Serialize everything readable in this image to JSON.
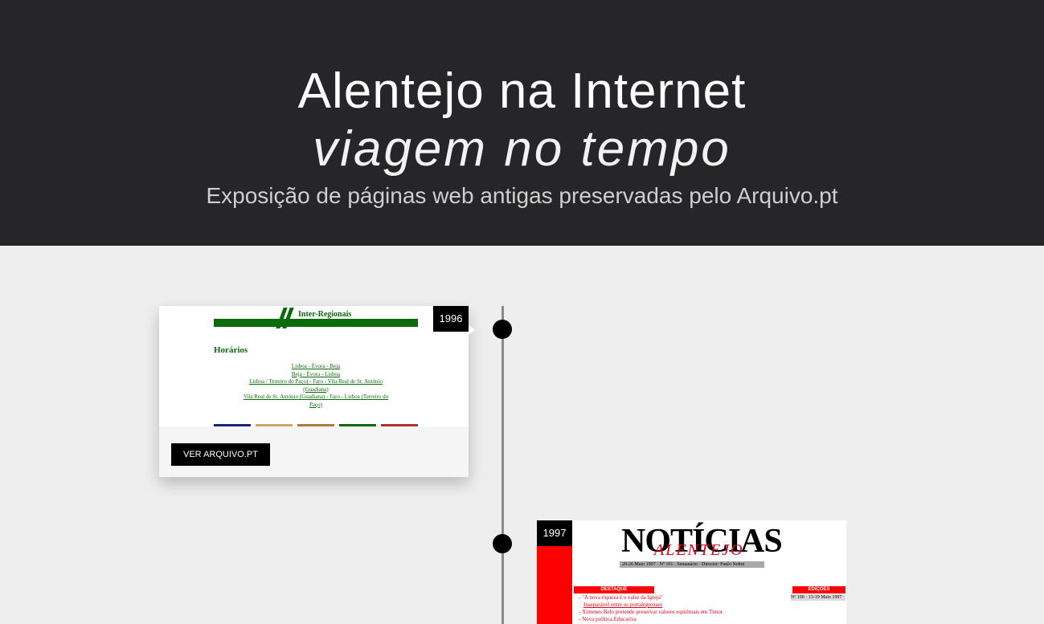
{
  "header": {
    "title": "Alentejo na Internet",
    "subtitle": "viagem no tempo",
    "description": "Exposição de páginas web antigas preservadas pelo Arquivo.pt"
  },
  "timeline": {
    "items": [
      {
        "year": "1996",
        "button_label": "VER ARQUIVO.PT",
        "screenshot": {
          "site_title": "Inter-Regionais",
          "heading": "Horários",
          "links": [
            "Lisboa - Évora - Beja",
            "Beja - Évora - Lisboa",
            "Lisboa / Terreiro do Paço) - Faro - Vila Real de St. António (Guadiana)",
            "Vila Real de St. António (Guadiana) - Faro - Lisboa (Terreiro do Paço)"
          ],
          "tab_colors": [
            "#1a237e",
            "#c9a56b",
            "#b07a3a",
            "#0b6b0b",
            "#a33"
          ]
        }
      },
      {
        "year": "1997",
        "screenshot": {
          "masthead": "NOTÍCIAS",
          "masthead_sub": "ALENTEJO",
          "dateline": "20-26 Maio 1997 · Nº 101 · Semanário · Director: Paulo Nobre",
          "destaque_label": "DESTAQUE",
          "edicoes_label": "EDIÇÕES ANTERIORES",
          "edicoes_item": "Nº 100 · 13-19 Maio 1997",
          "items": [
            "- \"A nova riqueza é o valor da Igreja\"",
            "Inseparável entre os portalegrenses",
            "- Ximenes Belo pretende preservar valores espirituais em Timor",
            "- Nova política Educativa"
          ]
        }
      }
    ]
  },
  "colors": {
    "header_bg": "#262628",
    "page_bg": "#eeeeee",
    "green": "#0b6b0b",
    "red": "#ff0000"
  }
}
